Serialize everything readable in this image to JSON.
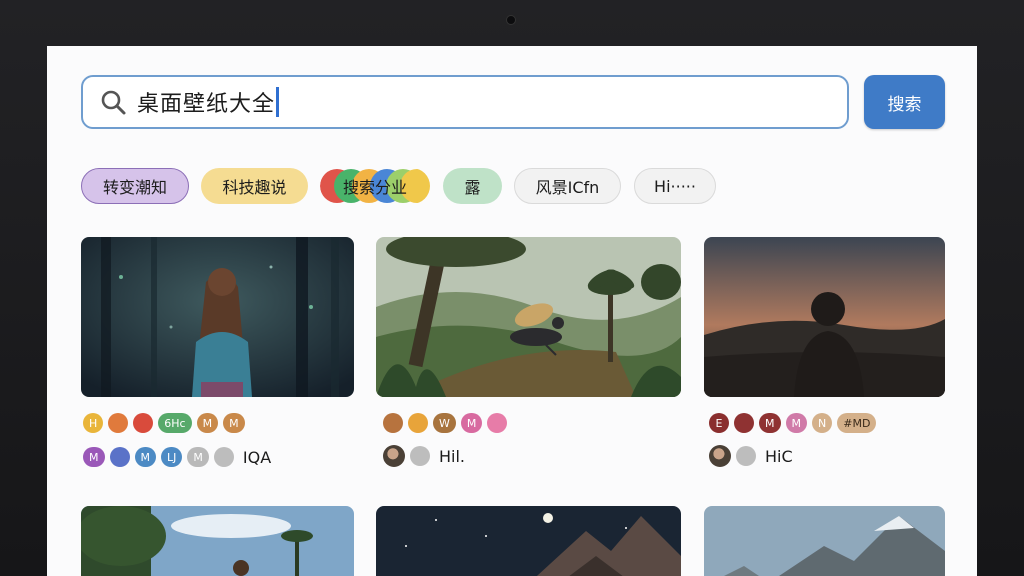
{
  "search": {
    "query": "桌面壁纸大全",
    "button_label": "搜索"
  },
  "chips": [
    "转变潮知",
    "科技趣说",
    "搜索分业",
    "露",
    "风景ICfn",
    "Hi·····"
  ],
  "cards": [
    {
      "tags_row1": [
        "H",
        "",
        "",
        "6Hc",
        "M",
        "M"
      ],
      "tags_row2": [
        "M",
        "",
        "M",
        "LJ",
        "M",
        ""
      ],
      "caption": "IQA"
    },
    {
      "tags_row1": [
        "",
        "",
        "W",
        "M",
        ""
      ],
      "caption": "Hil."
    },
    {
      "tags_row1": [
        "E",
        "",
        "M",
        "M",
        "N",
        "#MD"
      ],
      "caption": "HiC"
    }
  ],
  "colors": {
    "accent": "#3f7bc7",
    "search_border": "#6f9dcf",
    "screen_bg": "#fbfbfc"
  }
}
